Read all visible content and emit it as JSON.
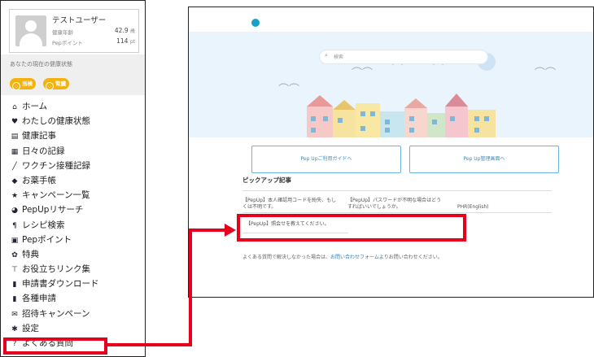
{
  "sidebar": {
    "user_name": "テストユーザー",
    "stats": [
      {
        "label": "健康年齢",
        "value": "42.9",
        "unit": "歳"
      },
      {
        "label": "Pepポイント",
        "value": "114",
        "unit": "pt"
      }
    ],
    "health_status_label": "あなたの現在の健康状態",
    "badges": [
      {
        "text": "当検",
        "color": "#f3b20e"
      },
      {
        "text": "腎臓",
        "color": "#f3b20e"
      }
    ],
    "nav_items": [
      {
        "icon": "home-icon",
        "glyph": "⌂",
        "label": "ホーム"
      },
      {
        "icon": "heart-icon",
        "glyph": "♥",
        "label": "わたしの健康状態"
      },
      {
        "icon": "newspaper-icon",
        "glyph": "▤",
        "label": "健康記事"
      },
      {
        "icon": "calendar-icon",
        "glyph": "▦",
        "label": "日々の記録"
      },
      {
        "icon": "syringe-icon",
        "glyph": "╱",
        "label": "ワクチン接種記録"
      },
      {
        "icon": "pill-icon",
        "glyph": "◆",
        "label": "お薬手帳"
      },
      {
        "icon": "star-icon",
        "glyph": "★",
        "label": "キャンペーン一覧"
      },
      {
        "icon": "pie-chart-icon",
        "glyph": "◕",
        "label": "PepUpリサーチ"
      },
      {
        "icon": "utensils-icon",
        "glyph": "¶",
        "label": "レシピ検索"
      },
      {
        "icon": "points-icon",
        "glyph": "▣",
        "label": "Pepポイント"
      },
      {
        "icon": "gift-icon",
        "glyph": "✿",
        "label": "特典"
      },
      {
        "icon": "pin-icon",
        "glyph": "⊤",
        "label": "お役立ちリンク集"
      },
      {
        "icon": "file-icon",
        "glyph": "▮",
        "label": "申請書ダウンロード"
      },
      {
        "icon": "document-icon",
        "glyph": "▮",
        "label": "各種申請"
      },
      {
        "icon": "invite-icon",
        "glyph": "✉",
        "label": "招待キャンペーン"
      },
      {
        "icon": "gear-icon",
        "glyph": "✱",
        "label": "設定"
      },
      {
        "icon": "question-circle-icon",
        "glyph": "?",
        "label": "よくある質問"
      }
    ]
  },
  "panel": {
    "search_placeholder": "検索",
    "btn_usage_guide": "Pep Upご利用ガイドへ",
    "btn_admin_guide": "Pep Up管理画面へ",
    "pickup_title": "ピックアップ記事",
    "articles": [
      "【PepUp】本人確認用コードを紛失、もしくは不明です。",
      "【PepUp】パスワードが不明な場合はどうすればいいでしょうか。",
      "PHR(English)",
      "【PepUp】照会せを教えてください。"
    ],
    "footer_text": "よくある質問で解決しなかった場合は、",
    "footer_link": "お問い合わせフォーム",
    "footer_suffix": "よりお問い合わせください。"
  },
  "colors": {
    "highlight": "#e6001e",
    "accent": "#1aa0c8",
    "badge": "#f3b20e"
  }
}
